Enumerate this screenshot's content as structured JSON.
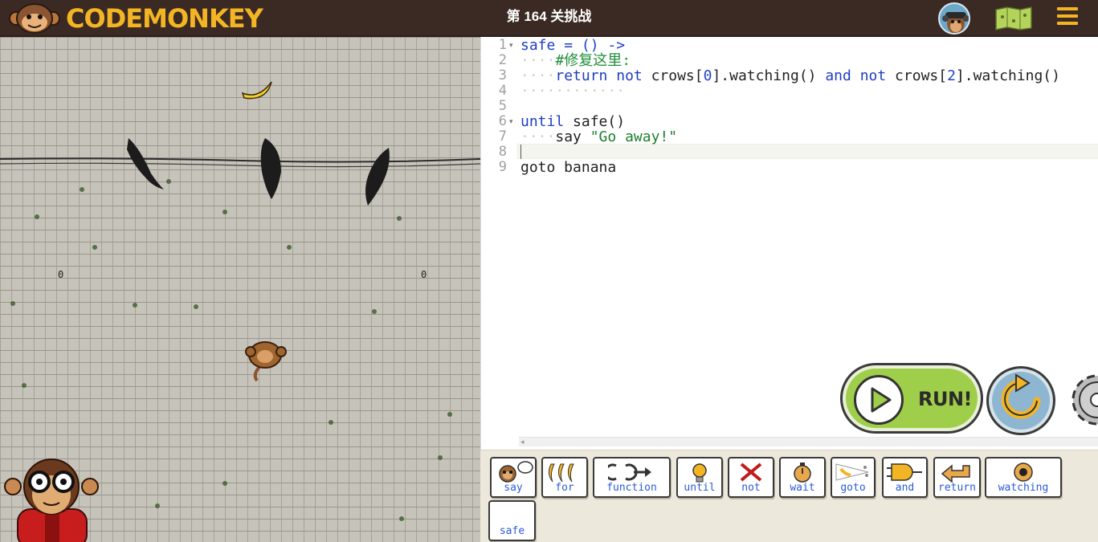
{
  "header": {
    "logo_text_1": "CODE",
    "logo_text_2": "MONKEY",
    "level_title": "第 164 关挑战"
  },
  "editor": {
    "line_numbers": [
      "1",
      "2",
      "3",
      "4",
      "5",
      "6",
      "7",
      "8",
      "9"
    ],
    "lines": [
      {
        "tokens": [
          {
            "t": "safe",
            "c": "kw"
          },
          {
            "t": " = () ->",
            "c": "kw"
          }
        ]
      },
      {
        "tokens": [
          {
            "t": "····",
            "c": "ws"
          },
          {
            "t": "#修复这里:",
            "c": "cm"
          }
        ]
      },
      {
        "tokens": [
          {
            "t": "····",
            "c": "ws"
          },
          {
            "t": "return",
            "c": "kw"
          },
          {
            "t": " ",
            "c": ""
          },
          {
            "t": "not",
            "c": "kw"
          },
          {
            "t": " crows[",
            "c": ""
          },
          {
            "t": "0",
            "c": "nu"
          },
          {
            "t": "].watching() ",
            "c": ""
          },
          {
            "t": "and",
            "c": "kw"
          },
          {
            "t": " ",
            "c": ""
          },
          {
            "t": "not",
            "c": "kw"
          },
          {
            "t": " crows[",
            "c": ""
          },
          {
            "t": "2",
            "c": "nu"
          },
          {
            "t": "].watching()",
            "c": ""
          }
        ]
      },
      {
        "tokens": [
          {
            "t": "············",
            "c": "ws"
          }
        ]
      },
      {
        "tokens": []
      },
      {
        "tokens": [
          {
            "t": "until",
            "c": "kw"
          },
          {
            "t": " safe()",
            "c": ""
          }
        ]
      },
      {
        "tokens": [
          {
            "t": "····",
            "c": "ws"
          },
          {
            "t": "say ",
            "c": ""
          },
          {
            "t": "\"Go away!\"",
            "c": "st"
          }
        ]
      },
      {
        "tokens": []
      },
      {
        "tokens": [
          {
            "t": "goto banana",
            "c": ""
          }
        ]
      }
    ]
  },
  "controls": {
    "run_label": "RUN!"
  },
  "palette": {
    "tiles": [
      "say",
      "for",
      "function",
      "until",
      "not",
      "wait",
      "goto",
      "and",
      "return",
      "watching",
      "safe"
    ]
  },
  "colors": {
    "topbar": "#3a2a23",
    "accent": "#f4b524",
    "run_green": "#9fcf4a",
    "reset_blue": "#8fb6d0",
    "keyword": "#1f3dc4",
    "comment": "#1f8f3a"
  },
  "icons": {
    "avatar": "monkey-avatar-icon",
    "map": "map-icon",
    "menu": "hamburger-menu-icon",
    "run": "play-icon",
    "reset": "reset-icon",
    "settings": "gear-icon"
  }
}
